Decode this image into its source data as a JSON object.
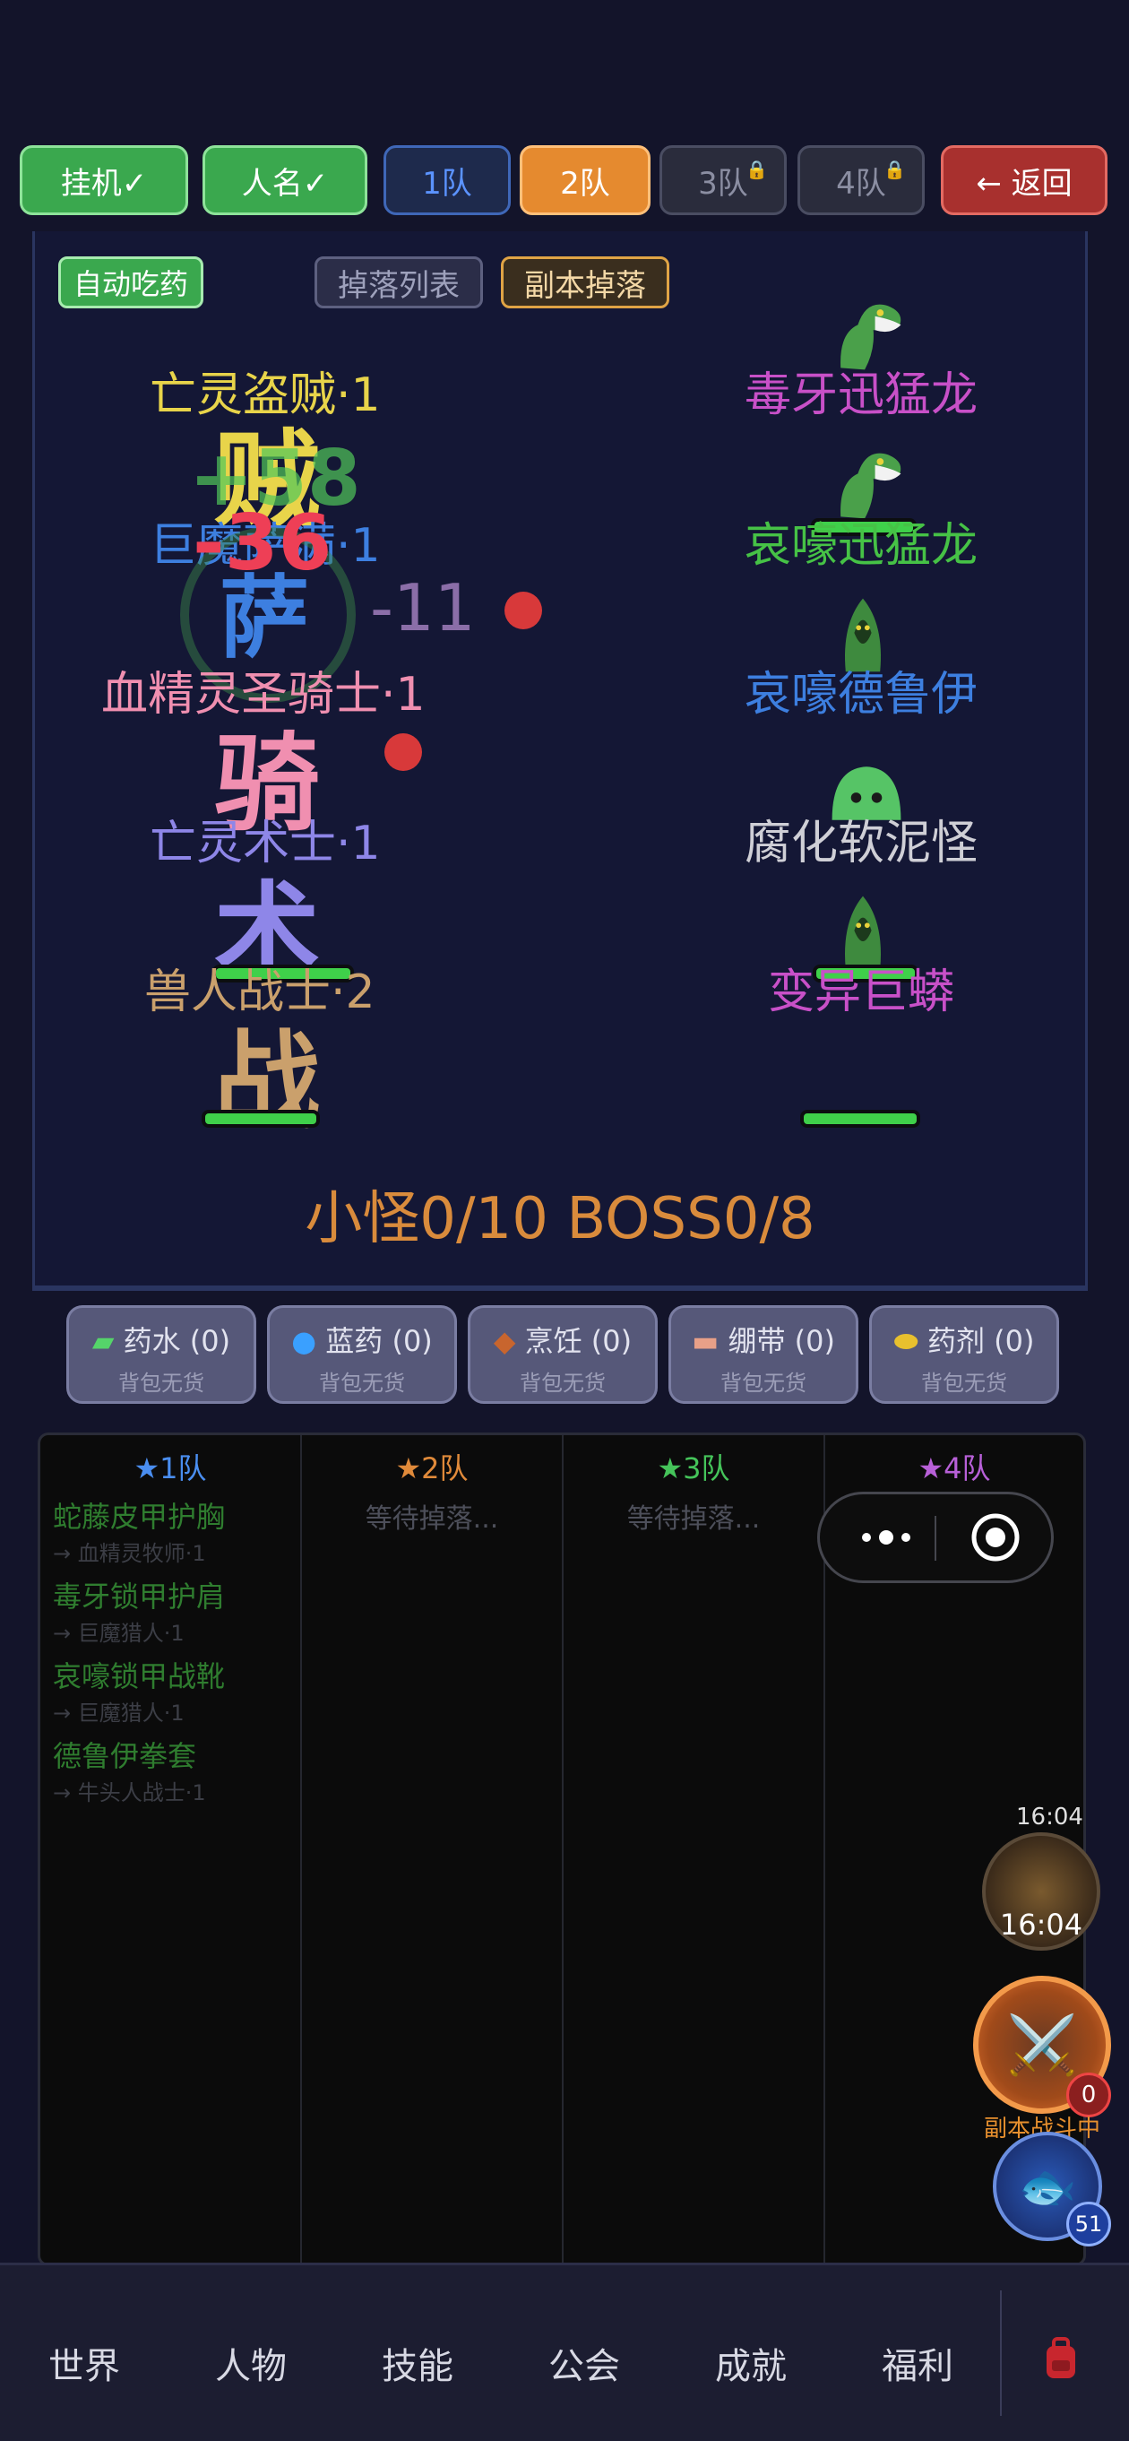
{
  "top_buttons": {
    "idle": "挂机✓",
    "names": "人名✓",
    "team1": "1队",
    "team2": "2队",
    "team3": "3队",
    "team4": "4队",
    "back": "← 返回"
  },
  "battle": {
    "auto_potion": "自动吃药",
    "drop_list": "掉落列表",
    "dungeon_drop": "副本掉落",
    "heroes": [
      {
        "name": "亡灵盗贼·1",
        "char": "贼",
        "color": "#e8d44a",
        "hp": 1.0
      },
      {
        "name": "巨魔萨满·1",
        "char": "萨",
        "color": "#3d7fe0",
        "hp": 1.0
      },
      {
        "name": "血精灵圣骑士·1",
        "char": "骑",
        "color": "#f08fb0",
        "hp": 1.0
      },
      {
        "name": "亡灵术士·1",
        "char": "术",
        "color": "#8e86e8",
        "hp": 1.0
      },
      {
        "name": "兽人战士·2",
        "char": "战",
        "color": "#caa06c",
        "hp": 1.0
      }
    ],
    "monsters": [
      {
        "name": "毒牙迅猛龙",
        "color": "#c850c8"
      },
      {
        "name": "哀嚎迅猛龙",
        "color": "#46c246"
      },
      {
        "name": "哀嚎德鲁伊",
        "color": "#3d7fe0"
      },
      {
        "name": "腐化软泥怪",
        "color": "#cfcfd6"
      },
      {
        "name": "变异巨蟒",
        "color": "#c850c8"
      }
    ],
    "floats": {
      "heal": "+58",
      "dmg1": "-36",
      "dmg2": "-11"
    },
    "counter": "小怪0/10  BOSS0/8"
  },
  "items": [
    {
      "label": "药水 (0)",
      "sub": "背包无货",
      "icon": "potion-icon"
    },
    {
      "label": "蓝药 (0)",
      "sub": "背包无货",
      "icon": "mana-icon"
    },
    {
      "label": "烹饪 (0)",
      "sub": "背包无货",
      "icon": "meat-icon"
    },
    {
      "label": "绷带 (0)",
      "sub": "背包无货",
      "icon": "bandage-icon"
    },
    {
      "label": "药剂 (0)",
      "sub": "背包无货",
      "icon": "pill-icon"
    }
  ],
  "loot": {
    "columns": [
      {
        "title": "★1队",
        "color": "#4a8ef0"
      },
      {
        "title": "★2队",
        "color": "#e08a3a"
      },
      {
        "title": "★3队",
        "color": "#45c45a"
      },
      {
        "title": "★4队",
        "color": "#b860d8"
      }
    ],
    "waiting": "等待掉落...",
    "waiting_cut": "等待掉落",
    "team1_drops": [
      {
        "item": "蛇藤皮甲护胸",
        "src": "→ 血精灵牧师·1"
      },
      {
        "item": "毒牙锁甲护肩",
        "src": "→ 巨魔猎人·1"
      },
      {
        "item": "哀嚎锁甲战靴",
        "src": "→ 巨魔猎人·1"
      },
      {
        "item": "德鲁伊拳套",
        "src": "→ 牛头人战士·1"
      }
    ]
  },
  "side": {
    "time_small": "16:04",
    "time_big": "16:04",
    "battle_badge": "0",
    "battle_label": "副本战斗中",
    "fish_badge": "51"
  },
  "nav": [
    "世界",
    "人物",
    "技能",
    "公会",
    "成就",
    "福利"
  ]
}
